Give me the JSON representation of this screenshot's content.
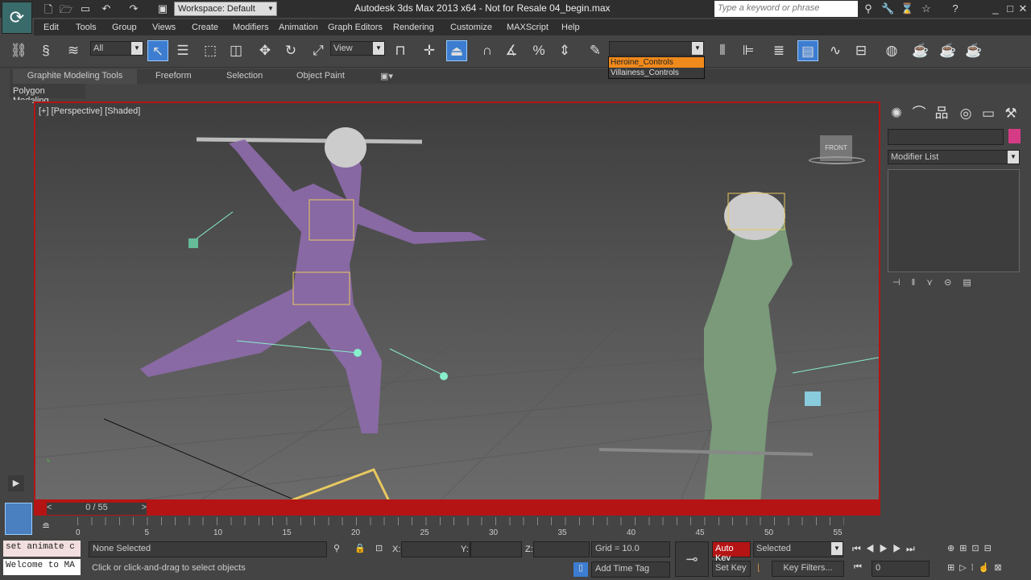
{
  "app": {
    "title": "Autodesk 3ds Max  2013 x64  - Not for Resale    04_begin.max",
    "workspace": "Workspace: Default",
    "search_placeholder": "Type a keyword or phrase"
  },
  "menu": [
    "Edit",
    "Tools",
    "Group",
    "Views",
    "Create",
    "Modifiers",
    "Animation",
    "Graph Editors",
    "Rendering",
    "Customize",
    "MAXScript",
    "Help"
  ],
  "toolbar": {
    "selection_filter": "All",
    "reference_coord": "View",
    "named_selection": "",
    "named_selection_options": [
      "Heroine_Controls",
      "Villainess_Controls"
    ],
    "highlighted_option": "Heroine_Controls"
  },
  "ribbon": {
    "tabs": [
      "Graphite Modeling Tools",
      "Freeform",
      "Selection",
      "Object Paint"
    ],
    "panel": "Polygon Modeling"
  },
  "viewport": {
    "label": "[+] [Perspective] [Shaded]",
    "viewcube_label": "FRONT"
  },
  "command_panel": {
    "modifier_list": "Modifier List",
    "name_field": "",
    "color": "#d63c86"
  },
  "timeline": {
    "frame": "0 / 55",
    "ticks": [
      "0",
      "5",
      "10",
      "15",
      "20",
      "25",
      "30",
      "35",
      "40",
      "45",
      "50",
      "55"
    ]
  },
  "status": {
    "maxscript_line1": "set animate c",
    "maxscript_line2": "Welcome to MA",
    "selection": "None Selected",
    "prompt": "Click or click-and-drag to select objects",
    "x_label": "X:",
    "y_label": "Y:",
    "z_label": "Z:",
    "x": "",
    "y": "",
    "z": "",
    "grid": "Grid = 10.0",
    "add_time_tag": "Add Time Tag",
    "auto_key": "Auto Key",
    "set_key": "Set Key",
    "key_mode": "Selected",
    "key_filters": "Key Filters...",
    "current_frame": "0"
  },
  "colors": {
    "active_border": "#b51414",
    "auto_key": "#b51414",
    "selection_highlight": "#3d7dd1",
    "dropdown_highlight": "#f08a1c"
  }
}
